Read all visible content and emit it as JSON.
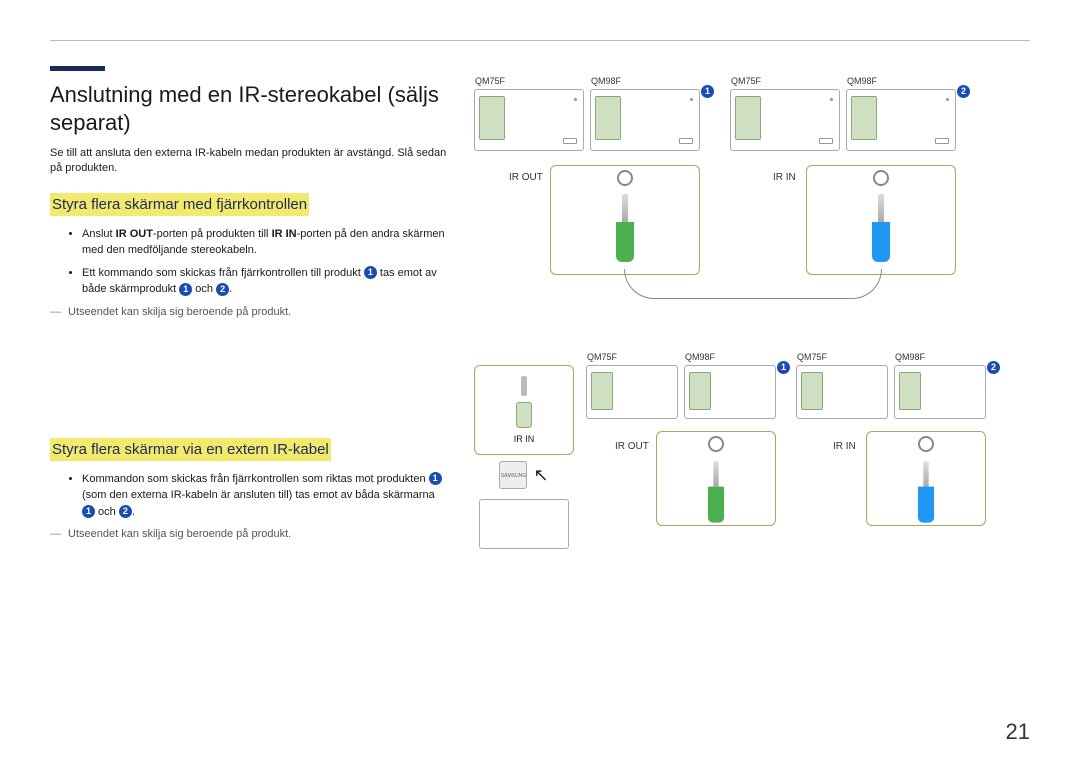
{
  "page_number": "21",
  "title": "Anslutning med en IR-stereokabel (säljs separat)",
  "intro": "Se till att ansluta den externa IR-kabeln medan produkten är avstängd. Slå sedan på produkten.",
  "section1": {
    "heading": "Styra flera skärmar med fjärrkontrollen",
    "bullet1_a": "Anslut ",
    "bullet1_b": "IR OUT",
    "bullet1_c": "-porten på produkten till ",
    "bullet1_d": "IR IN",
    "bullet1_e": "-porten på den andra skärmen med den medföljande stereokabeln.",
    "bullet2_a": "Ett kommando som skickas från fjärrkontrollen till produkt ",
    "bullet2_b": " tas emot av både skärmprodukt ",
    "bullet2_c": " och ",
    "bullet2_d": ".",
    "note": "Utseendet kan skilja sig beroende på produkt."
  },
  "section2": {
    "heading": "Styra flera skärmar via en extern IR-kabel",
    "bullet1_a": "Kommandon som skickas från fjärrkontrollen som riktas mot produkten ",
    "bullet1_b": " (som den externa IR-kabeln är ansluten till) tas emot av båda skärmarna ",
    "bullet1_c": " och ",
    "bullet1_d": ".",
    "note": "Utseendet kan skilja sig beroende på produkt."
  },
  "labels": {
    "qm75f": "QM75F",
    "qm98f": "QM98F",
    "ir_out": "IR OUT",
    "ir_in": "IR IN",
    "samsung": "SAMSUNG"
  },
  "badges": {
    "one": "1",
    "two": "2"
  }
}
